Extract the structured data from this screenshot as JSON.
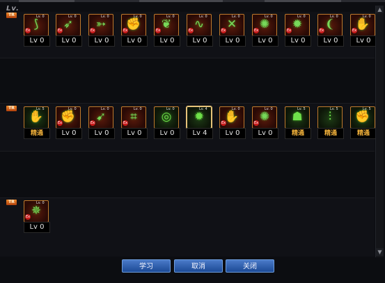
{
  "header": {
    "lv_label": "Lv."
  },
  "scrollbar": {
    "up_glyph": "▲",
    "down_glyph": "▼"
  },
  "tier_badge": "TR",
  "rows": [
    {
      "skills": [
        {
          "label": "Lv 0",
          "mini": "Lv. 0",
          "icon": "claw-strike-icon",
          "glyph": "⟆",
          "theme": "red"
        },
        {
          "label": "Lv 0",
          "mini": "Lv. 0",
          "icon": "arrow-kick-icon",
          "glyph": "➶",
          "theme": "red"
        },
        {
          "label": "Lv 0",
          "mini": "Lv. 0",
          "icon": "dash-strike-icon",
          "glyph": "➳",
          "theme": "red"
        },
        {
          "label": "Lv 0",
          "mini": "Lv. 0",
          "icon": "fist-swing-icon",
          "glyph": "✊",
          "theme": "red"
        },
        {
          "label": "Lv 0",
          "mini": "Lv. 0",
          "icon": "leaf-gust-icon",
          "glyph": "❦",
          "theme": "red"
        },
        {
          "label": "Lv 0",
          "mini": "Lv. 0",
          "icon": "whip-icon",
          "glyph": "∿",
          "theme": "red"
        },
        {
          "label": "Lv 0",
          "mini": "Lv. 0",
          "icon": "cross-slash-icon",
          "glyph": "✕",
          "theme": "red"
        },
        {
          "label": "Lv 0",
          "mini": "Lv. 0",
          "icon": "spiral-kick-icon",
          "glyph": "✺",
          "theme": "red"
        },
        {
          "label": "Lv 0",
          "mini": "Lv. 0",
          "icon": "beast-head-icon",
          "glyph": "✹",
          "theme": "red"
        },
        {
          "label": "Lv 0",
          "mini": "Lv. 0",
          "icon": "swing-arc-icon",
          "glyph": "❨",
          "theme": "red"
        },
        {
          "label": "Lv 0",
          "mini": "Lv. 0",
          "icon": "gauntlet-icon",
          "glyph": "✋",
          "theme": "red"
        }
      ]
    },
    {
      "skills": [
        {
          "label": "精通",
          "mini": "Lv. 5",
          "icon": "tiger-claw-icon",
          "glyph": "✋",
          "theme": "green",
          "mastered": true
        },
        {
          "label": "Lv 0",
          "mini": "Lv. 0",
          "icon": "flame-fist-icon",
          "glyph": "✊",
          "theme": "red"
        },
        {
          "label": "Lv 0",
          "mini": "Lv. 0",
          "icon": "crescent-kick-icon",
          "glyph": "➹",
          "theme": "red"
        },
        {
          "label": "Lv 0",
          "mini": "Lv. 0",
          "icon": "net-icon",
          "glyph": "⌗",
          "theme": "red"
        },
        {
          "label": "Lv 0",
          "mini": "Lv. 0",
          "icon": "vortex-icon",
          "glyph": "◎",
          "theme": "green"
        },
        {
          "label": "Lv 4",
          "mini": "Lv. 4",
          "icon": "rage-head-icon",
          "glyph": "✹",
          "theme": "green",
          "selected": true
        },
        {
          "label": "Lv 0",
          "mini": "Lv. 0",
          "icon": "shadow-palm-icon",
          "glyph": "✋",
          "theme": "red"
        },
        {
          "label": "Lv 0",
          "mini": "Lv. 0",
          "icon": "tornado-kick-icon",
          "glyph": "✺",
          "theme": "red"
        },
        {
          "label": "精通",
          "mini": "Lv. 5",
          "icon": "demon-mask-icon",
          "glyph": "☗",
          "theme": "green",
          "mastered": true
        },
        {
          "label": "精通",
          "mini": "Lv. 5",
          "icon": "pillar-strike-icon",
          "glyph": "⫶",
          "theme": "green",
          "mastered": true
        },
        {
          "label": "精通",
          "mini": "Lv. 5",
          "icon": "power-fist-icon",
          "glyph": "✊",
          "theme": "green",
          "mastered": true
        }
      ]
    },
    {
      "skills": [
        {
          "label": "Lv 0",
          "mini": "Lv. 0",
          "icon": "berserker-icon",
          "glyph": "✵",
          "theme": "red"
        }
      ]
    }
  ],
  "buttons": {
    "learn": "学习",
    "cancel": "取消",
    "close": "关闭"
  }
}
